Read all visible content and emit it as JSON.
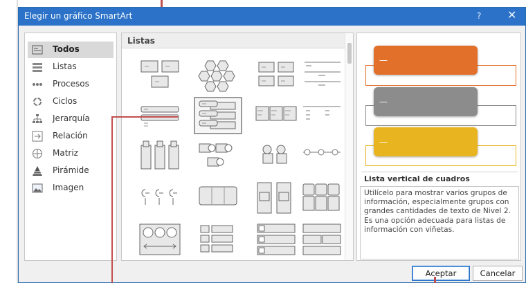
{
  "window": {
    "title": "Elegir un gráfico SmartArt",
    "help_label": "?",
    "close_label": "✕"
  },
  "categories": [
    {
      "label": "Todos",
      "icon": "all-layouts-icon",
      "selected": true
    },
    {
      "label": "Listas",
      "icon": "list-icon"
    },
    {
      "label": "Procesos",
      "icon": "process-icon"
    },
    {
      "label": "Ciclos",
      "icon": "cycle-icon"
    },
    {
      "label": "Jerarquía",
      "icon": "hierarchy-icon"
    },
    {
      "label": "Relación",
      "icon": "relationship-icon"
    },
    {
      "label": "Matriz",
      "icon": "matrix-icon"
    },
    {
      "label": "Pirámide",
      "icon": "pyramid-icon"
    },
    {
      "label": "Imagen",
      "icon": "picture-icon"
    }
  ],
  "gallery": {
    "header": "Listas",
    "selected_layout": "Lista vertical de cuadros"
  },
  "preview": {
    "name": "Lista vertical de cuadros",
    "bar_dash": "—",
    "description": "Utilícelo para mostrar varios grupos de información, especialmente grupos con grandes cantidades de texto de Nivel 2. Es una opción adecuada para listas de información con viñetas.",
    "colors": [
      "#e2702a",
      "#8c8c8c",
      "#e8b420"
    ]
  },
  "buttons": {
    "ok_label": "Aceptar",
    "cancel_label": "Cancelar"
  }
}
